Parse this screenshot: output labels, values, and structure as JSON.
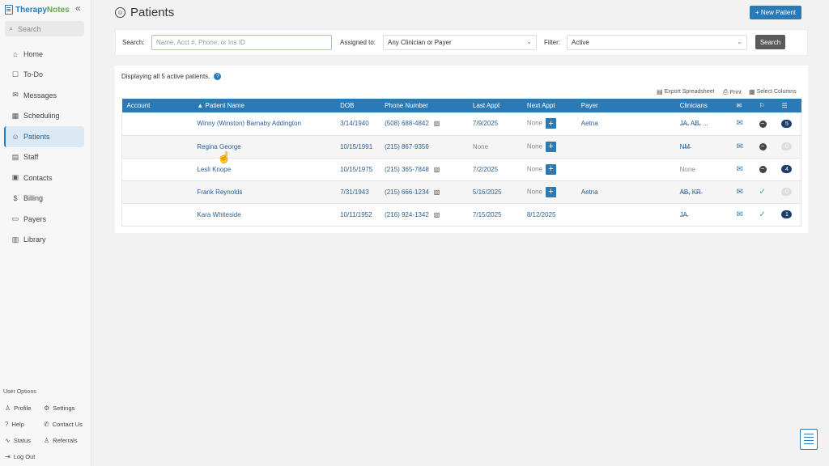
{
  "logo": {
    "part1": "Therapy",
    "part2": "Notes"
  },
  "sidebar": {
    "search_placeholder": "Search",
    "items": [
      {
        "label": "Home",
        "icon": "⌂"
      },
      {
        "label": "To-Do",
        "icon": "☐"
      },
      {
        "label": "Messages",
        "icon": "✉"
      },
      {
        "label": "Scheduling",
        "icon": "▦"
      },
      {
        "label": "Patients",
        "icon": "☺"
      },
      {
        "label": "Staff",
        "icon": "▤"
      },
      {
        "label": "Contacts",
        "icon": "▣"
      },
      {
        "label": "Billing",
        "icon": "$"
      },
      {
        "label": "Payers",
        "icon": "▭"
      },
      {
        "label": "Library",
        "icon": "▥"
      }
    ],
    "user_options_title": "User Options",
    "user_options": {
      "profile": "Profile",
      "settings": "Settings",
      "help": "Help",
      "contact_us": "Contact Us",
      "status": "Status",
      "referrals": "Referrals",
      "logout": "Log Out"
    }
  },
  "header": {
    "title": "Patients",
    "new_patient": "+ New Patient"
  },
  "filters": {
    "search_label": "Search:",
    "search_placeholder": "Name, Acct #, Phone, or Ins ID",
    "assigned_label": "Assigned to:",
    "assigned_value": "Any Clinician or Payer",
    "filter_label": "Filter:",
    "filter_value": "Active",
    "search_button": "Search"
  },
  "list": {
    "display_text": "Displaying all 5 active patients.",
    "export": "Export Spreadsheet",
    "print": "Print",
    "select_columns": "Select Columns",
    "columns": {
      "account": "Account",
      "name": "▲ Patient Name",
      "dob": "DOB",
      "phone": "Phone Number",
      "last_appt": "Last Appt",
      "next_appt": "Next Appt",
      "payer": "Payer",
      "clinicians": "Clinicians"
    },
    "rows": [
      {
        "name": "Winny (Winston) Barnaby Addington",
        "dob": "3/14/1940",
        "phone": "(508) 688-4842",
        "last": "7/9/2025",
        "next": "None",
        "payer": "Aetna",
        "clin": "J̶A̶, A̶B̶, ...",
        "count": "5"
      },
      {
        "name": "Regina George",
        "dob": "10/15/1991",
        "phone": "(215) 867-9356",
        "last": "None",
        "next": "None",
        "payer": "",
        "clin": "N̶M̶",
        "count": "0"
      },
      {
        "name": "Lesli Knope",
        "dob": "10/15/1975",
        "phone": "(215) 365-7848",
        "last": "7/2/2025",
        "next": "None",
        "payer": "",
        "clin": "None",
        "count": "4"
      },
      {
        "name": "Frank Reynolds",
        "dob": "7/31/1943",
        "phone": "(215) 666-1234",
        "last": "5/16/2025",
        "next": "None",
        "payer": "Aetna",
        "clin": "A̶B̶, K̶R̶",
        "count": "0"
      },
      {
        "name": "Kara Whiteside",
        "dob": "10/11/1952",
        "phone": "(216) 924-1342",
        "last": "7/15/2025",
        "next": "8/12/2025",
        "payer": "",
        "clin": "J̶A̶",
        "count": "1"
      }
    ]
  }
}
